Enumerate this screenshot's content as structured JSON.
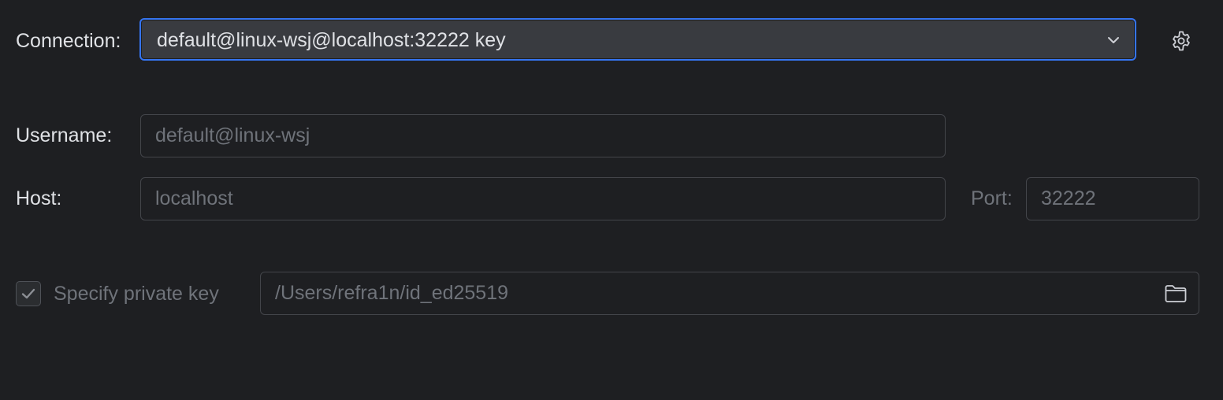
{
  "connection": {
    "label": "Connection:",
    "selected_value": "default@linux-wsj@localhost:32222 key",
    "dropdown_icon": "chevron-down-icon",
    "settings_icon": "gear-icon"
  },
  "username": {
    "label": "Username:",
    "value": "default@linux-wsj"
  },
  "host": {
    "label": "Host:",
    "value": "localhost"
  },
  "port": {
    "label": "Port:",
    "value": "32222"
  },
  "private_key": {
    "checkbox_label": "Specify private key",
    "checked": true,
    "path": "/Users/refra1n/id_ed25519",
    "browse_icon": "folder-icon"
  },
  "colors": {
    "background": "#1e1f22",
    "focus_border": "#3574f0",
    "combo_background": "#393b40",
    "text": "#dfe1e5",
    "disabled_text": "#6f737a"
  }
}
